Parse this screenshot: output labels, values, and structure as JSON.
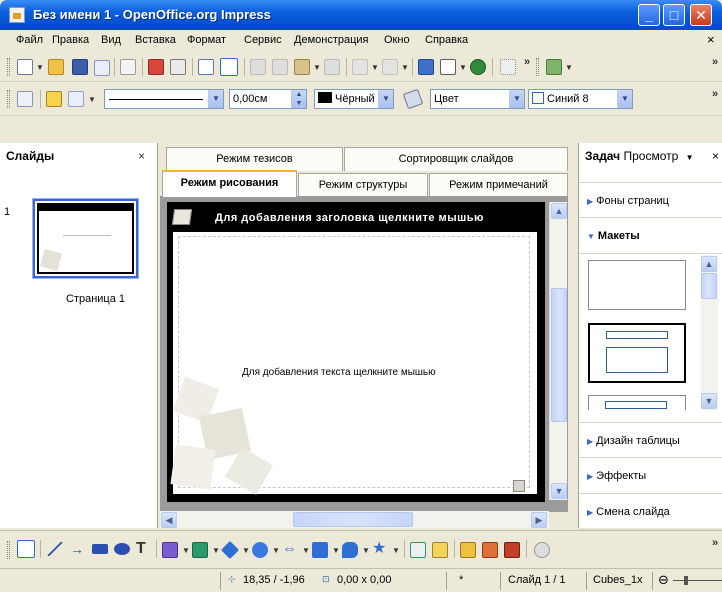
{
  "window": {
    "title": "Без имени 1 - OpenOffice.org Impress",
    "minimize": "_",
    "maximize": "□",
    "close": "✕"
  },
  "menu": {
    "items": [
      "Файл",
      "Правка",
      "Вид",
      "Вставка",
      "Формат",
      "Сервис",
      "Демонстрация",
      "Окно",
      "Справка"
    ],
    "close": "×"
  },
  "line_toolbar": {
    "width_value": "0,00см",
    "color_value": "Чёрный",
    "fill_type": "Цвет",
    "fill_color": "Синий 8",
    "accents": {
      "fill_swatch": "#000000",
      "blue_swatch": "#ffffff"
    }
  },
  "slides_panel": {
    "title": "Слайды",
    "close": "×",
    "slide_number": "1",
    "slide_name": "Страница 1"
  },
  "view_tabs": {
    "row1": [
      "Режим тезисов",
      "Сортировщик слайдов"
    ],
    "row2": [
      "Режим рисования",
      "Режим структуры",
      "Режим примечаний"
    ],
    "active": "Режим рисования"
  },
  "slide": {
    "title_placeholder": "Для добавления заголовка щелкните мышью",
    "body_placeholder": "Для добавления текста щелкните мышью"
  },
  "tasks_panel": {
    "title": "Задач",
    "view_menu": "Просмотр",
    "close": "×",
    "sections": {
      "backgrounds": "Фоны страниц",
      "layouts": "Макеты",
      "table_design": "Дизайн таблицы",
      "effects": "Эффекты",
      "transition": "Смена слайда"
    }
  },
  "statusbar": {
    "position": "18,35 / -1,96",
    "size": "0,00 x 0,00",
    "modified": "*",
    "slide": "Слайд 1 / 1",
    "design": "Cubes_1x",
    "zoom_minus": "⊖"
  }
}
